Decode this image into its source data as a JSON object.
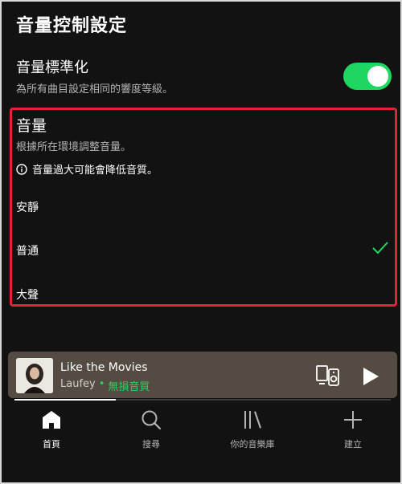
{
  "header": {
    "title": "音量控制設定"
  },
  "normalization": {
    "title": "音量標準化",
    "description": "為所有曲目設定相同的響度等級。",
    "enabled": true
  },
  "volume": {
    "title": "音量",
    "description": "根據所在環境調整音量。",
    "warning": "音量過大可能會降低音質。",
    "options": [
      {
        "label": "安靜",
        "selected": false
      },
      {
        "label": "普通",
        "selected": true
      },
      {
        "label": "大聲",
        "selected": false
      }
    ]
  },
  "now_playing": {
    "title": "Like the Movies",
    "artist": "Laufey",
    "separator": "•",
    "quality": "無損音質",
    "progress": 0.27
  },
  "nav": {
    "home": "首頁",
    "search": "搜尋",
    "library": "你的音樂庫",
    "create": "建立"
  },
  "colors": {
    "accent": "#1ed760",
    "highlight": "#e0243a",
    "background": "#121212",
    "player": "#544c42"
  }
}
